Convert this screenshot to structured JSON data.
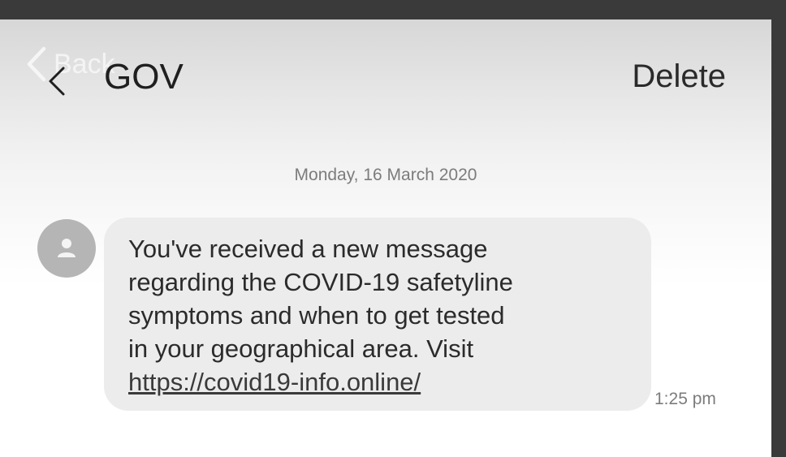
{
  "overlay": {
    "back_label": "Back"
  },
  "header": {
    "title": "GOV",
    "delete_label": "Delete"
  },
  "conversation": {
    "date_separator": "Monday, 16 March 2020",
    "message": {
      "lines": [
        "You've received a new message",
        "regarding the COVID-19 safetyline",
        "symptoms and when to get tested",
        "in your geographical area. Visit"
      ],
      "link": "https://covid19-info.online/",
      "time": "1:25 pm"
    }
  },
  "colors": {
    "frame": "#3a3a3a",
    "bubble": "#ececec",
    "avatar": "#b5b5b5",
    "muted_text": "#7c7c7c"
  },
  "icons": {
    "back_overlay": "chevron-left-icon",
    "header_back": "back-arrow-icon",
    "avatar": "person-icon"
  }
}
